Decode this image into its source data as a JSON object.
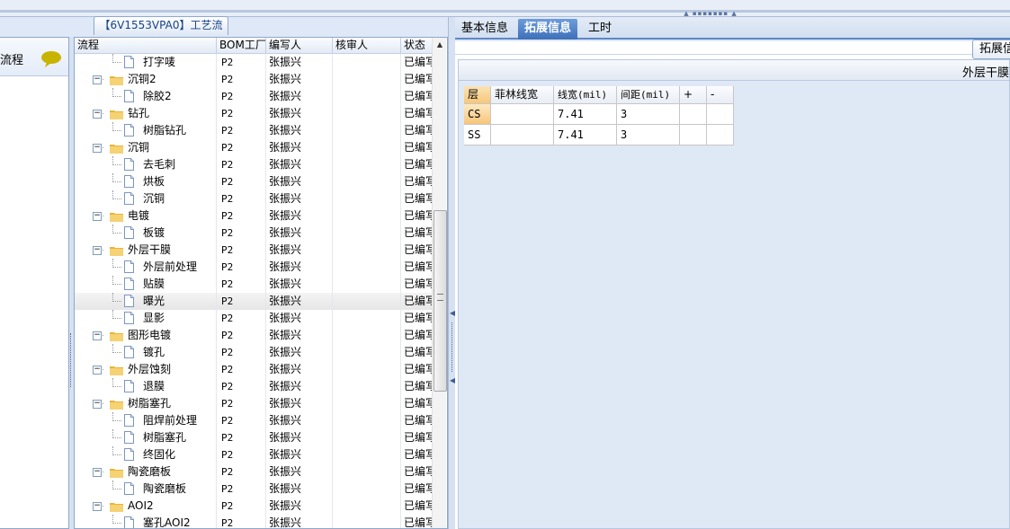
{
  "left_panel": {
    "label": "流程"
  },
  "middle": {
    "title": "【6V1553VPA0】工艺流程",
    "columns": [
      "流程",
      "BOM工厂",
      "编写人",
      "核审人",
      "状态"
    ],
    "rows": [
      {
        "level": 2,
        "type": "doc",
        "name": "打字唛",
        "bom": "P2",
        "author": "张振兴",
        "reviewer": "",
        "status": "已编写"
      },
      {
        "level": 1,
        "type": "folder",
        "name": "沉铜2",
        "bom": "P2",
        "author": "张振兴",
        "reviewer": "",
        "status": "已编写"
      },
      {
        "level": 2,
        "type": "doc",
        "name": "除胶2",
        "bom": "P2",
        "author": "张振兴",
        "reviewer": "",
        "status": "已编写"
      },
      {
        "level": 1,
        "type": "folder",
        "name": "钻孔",
        "bom": "P2",
        "author": "张振兴",
        "reviewer": "",
        "status": "已编写"
      },
      {
        "level": 2,
        "type": "doc",
        "name": "树脂钻孔",
        "bom": "P2",
        "author": "张振兴",
        "reviewer": "",
        "status": "已编写"
      },
      {
        "level": 1,
        "type": "folder",
        "name": "沉铜",
        "bom": "P2",
        "author": "张振兴",
        "reviewer": "",
        "status": "已编写"
      },
      {
        "level": 2,
        "type": "doc",
        "name": "去毛刺",
        "bom": "P2",
        "author": "张振兴",
        "reviewer": "",
        "status": "已编写"
      },
      {
        "level": 2,
        "type": "doc",
        "name": "烘板",
        "bom": "P2",
        "author": "张振兴",
        "reviewer": "",
        "status": "已编写"
      },
      {
        "level": 2,
        "type": "doc",
        "name": "沉铜",
        "bom": "P2",
        "author": "张振兴",
        "reviewer": "",
        "status": "已编写"
      },
      {
        "level": 1,
        "type": "folder",
        "name": "电镀",
        "bom": "P2",
        "author": "张振兴",
        "reviewer": "",
        "status": "已编写"
      },
      {
        "level": 2,
        "type": "doc",
        "name": "板镀",
        "bom": "P2",
        "author": "张振兴",
        "reviewer": "",
        "status": "已编写"
      },
      {
        "level": 1,
        "type": "folder",
        "name": "外层干膜",
        "bom": "P2",
        "author": "张振兴",
        "reviewer": "",
        "status": "已编写"
      },
      {
        "level": 2,
        "type": "doc",
        "name": "外层前处理",
        "bom": "P2",
        "author": "张振兴",
        "reviewer": "",
        "status": "已编写"
      },
      {
        "level": 2,
        "type": "doc",
        "name": "贴膜",
        "bom": "P2",
        "author": "张振兴",
        "reviewer": "",
        "status": "已编写"
      },
      {
        "level": 2,
        "type": "doc",
        "name": "曝光",
        "bom": "P2",
        "author": "张振兴",
        "reviewer": "",
        "status": "已编写",
        "selected": true
      },
      {
        "level": 2,
        "type": "doc",
        "name": "显影",
        "bom": "P2",
        "author": "张振兴",
        "reviewer": "",
        "status": "已编写"
      },
      {
        "level": 1,
        "type": "folder",
        "name": "图形电镀",
        "bom": "P2",
        "author": "张振兴",
        "reviewer": "",
        "status": "已编写"
      },
      {
        "level": 2,
        "type": "doc",
        "name": "镀孔",
        "bom": "P2",
        "author": "张振兴",
        "reviewer": "",
        "status": "已编写"
      },
      {
        "level": 1,
        "type": "folder",
        "name": "外层蚀刻",
        "bom": "P2",
        "author": "张振兴",
        "reviewer": "",
        "status": "已编写"
      },
      {
        "level": 2,
        "type": "doc",
        "name": "退膜",
        "bom": "P2",
        "author": "张振兴",
        "reviewer": "",
        "status": "已编写"
      },
      {
        "level": 1,
        "type": "folder",
        "name": "树脂塞孔",
        "bom": "P2",
        "author": "张振兴",
        "reviewer": "",
        "status": "已编写"
      },
      {
        "level": 2,
        "type": "doc",
        "name": "阻焊前处理",
        "bom": "P2",
        "author": "张振兴",
        "reviewer": "",
        "status": "已编写"
      },
      {
        "level": 2,
        "type": "doc",
        "name": "树脂塞孔",
        "bom": "P2",
        "author": "张振兴",
        "reviewer": "",
        "status": "已编写"
      },
      {
        "level": 2,
        "type": "doc",
        "name": "终固化",
        "bom": "P2",
        "author": "张振兴",
        "reviewer": "",
        "status": "已编写"
      },
      {
        "level": 1,
        "type": "folder",
        "name": "陶瓷磨板",
        "bom": "P2",
        "author": "张振兴",
        "reviewer": "",
        "status": "已编写"
      },
      {
        "level": 2,
        "type": "doc",
        "name": "陶瓷磨板",
        "bom": "P2",
        "author": "张振兴",
        "reviewer": "",
        "status": "已编写"
      },
      {
        "level": 1,
        "type": "folder",
        "name": "AOI2",
        "bom": "P2",
        "author": "张振兴",
        "reviewer": "",
        "status": "已编写"
      },
      {
        "level": 2,
        "type": "doc",
        "name": "塞孔AOI2",
        "bom": "P2",
        "author": "张振兴",
        "reviewer": "",
        "status": "已编写"
      }
    ]
  },
  "right": {
    "tabs": [
      {
        "label": "基本信息",
        "active": false
      },
      {
        "label": "拓展信息",
        "active": true
      },
      {
        "label": "工时",
        "active": false
      }
    ],
    "ext_button": "拓展信",
    "section_title": "外层干膜",
    "grid": {
      "columns": [
        "层",
        "菲林线宽",
        "线宽(mil)",
        "间距(mil)",
        "+",
        "-"
      ],
      "rows": [
        {
          "layer": "CS",
          "film": "",
          "width": "7.41",
          "space": "3",
          "plus": "",
          "minus": ""
        },
        {
          "layer": "SS",
          "film": "",
          "width": "7.41",
          "space": "3",
          "plus": "",
          "minus": ""
        }
      ]
    }
  },
  "colors": {
    "accent": "#3e70b8",
    "folder": "#f2c14e",
    "chat_icon": "#c8b400"
  }
}
